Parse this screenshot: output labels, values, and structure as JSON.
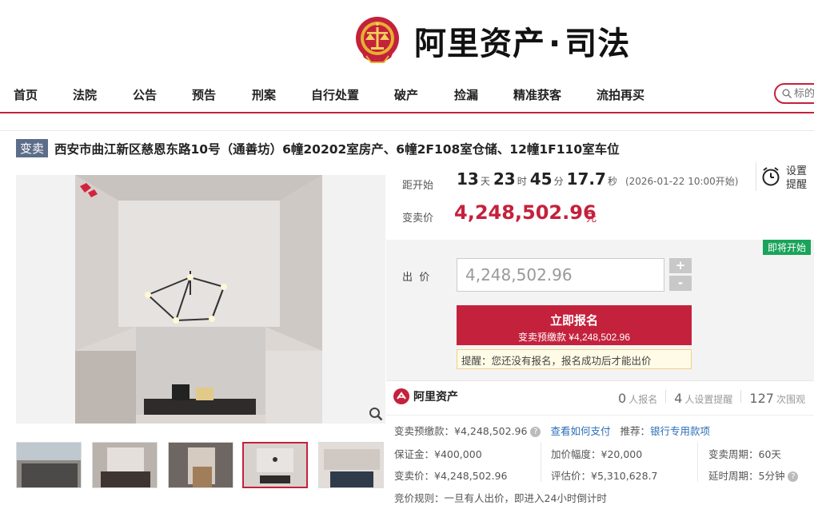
{
  "header": {
    "brand_main": "阿里资产",
    "brand_dot": "·",
    "brand_sub": "司法"
  },
  "nav": {
    "items": [
      "首页",
      "法院",
      "公告",
      "预告",
      "刑案",
      "自行处置",
      "破产",
      "捡漏",
      "精准获客",
      "流拍再买"
    ],
    "search_placeholder": "标的"
  },
  "listing": {
    "badge": "变卖",
    "title": "西安市曲江新区慈恩东路10号（通善坊）6幢20202室房产、6幢2F108室仓储、12幢1F110室车位"
  },
  "countdown": {
    "label": "距开始",
    "days": "13",
    "days_unit": "天",
    "hours": "23",
    "hours_unit": "时",
    "minutes": "45",
    "minutes_unit": "分",
    "seconds": "17.7",
    "seconds_unit": "秒",
    "start_note": "(2026-01-22 10:00开始)"
  },
  "reminder": {
    "line1": "设置",
    "line2": "提醒"
  },
  "price": {
    "label": "变卖价",
    "value": "4,248,502.96",
    "unit": "元"
  },
  "bid": {
    "status_tag": "即将开始",
    "label": "出  价",
    "input_value": "4,248,502.96",
    "plus": "+",
    "minus": "-",
    "signup_label": "立即报名",
    "signup_sub": "变卖预缴款 ¥4,248,502.96",
    "tip": "提醒：您还没有报名，报名成功后才能出价"
  },
  "info": {
    "logo_text": "阿里资产",
    "stats": [
      {
        "num": "0",
        "label": "人报名"
      },
      {
        "num": "4",
        "label": "人设置提醒"
      },
      {
        "num": "127",
        "label": "次围观"
      }
    ],
    "deposit_line": "变卖预缴款：¥4,248,502.96",
    "how_to_pay": "查看如何支付",
    "recommend_label": "推荐：",
    "recommend_link": "银行专用款项",
    "bond": "保证金：¥400,000",
    "increment": "加价幅度：¥20,000",
    "period": "变卖周期：60天",
    "sale_price": "变卖价：¥4,248,502.96",
    "appraisal": "评估价：¥5,310,628.7",
    "delay": "延时周期：5分钟",
    "rule": "竞价规则：一旦有人出价，即进入24小时倒计时"
  },
  "colors": {
    "accent": "#c4213c",
    "badge": "#5c6d8a",
    "status_green": "#1aa35a",
    "link": "#2a6db8"
  }
}
